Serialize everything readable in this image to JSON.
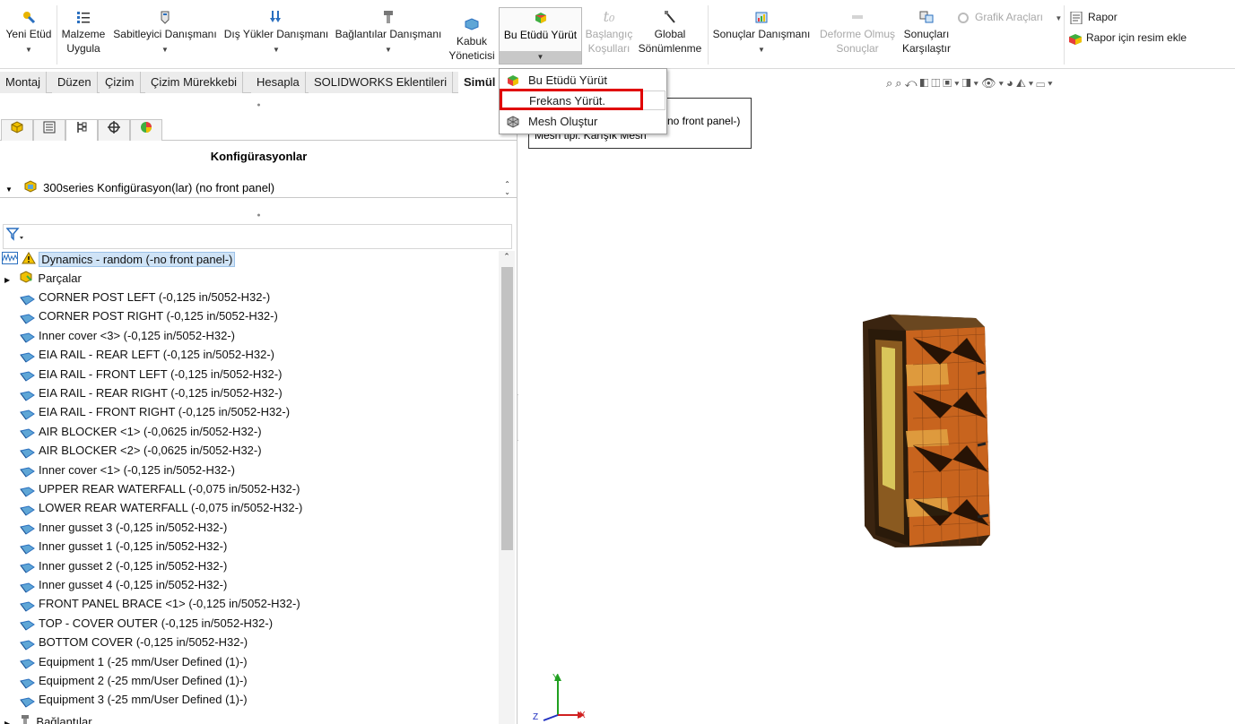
{
  "ribbon": {
    "yeni_etud": "Yeni Etüd",
    "malzeme_1": "Malzeme",
    "malzeme_2": "Uygula",
    "sabitleyici": "Sabitleyici Danışmanı",
    "dis_yukler": "Dış Yükler Danışmanı",
    "baglantilar": "Bağlantılar Danışmanı",
    "kabuk_1": "Kabuk",
    "kabuk_2": "Yöneticisi",
    "run": "Bu Etüdü Yürüt",
    "baslangic_1": "Başlangıç",
    "baslangic_2": "Koşulları",
    "global_1": "Global",
    "global_2": "Sönümlenme",
    "sonuclar": "Sonuçlar Danışmanı",
    "deforme_1": "Deforme Olmuş",
    "deforme_2": "Sonuçlar",
    "karsilastir_1": "Sonuçları",
    "karsilastir_2": "Karşılaştır",
    "grafik": "Grafik Araçları",
    "rapor": "Rapor",
    "rapor_resim": "Rapor için resim ekle"
  },
  "tabs": [
    "Montaj",
    "Düzen",
    "Çizim",
    "Çizim Mürekkebi",
    "Hesapla",
    "SOLIDWORKS Eklentileri",
    "Simül"
  ],
  "dropdown": {
    "items": [
      "Bu Etüdü Yürüt",
      "Frekans Yürüt.",
      "Mesh Oluştur"
    ]
  },
  "panel": {
    "title": "Konfigürasyonlar",
    "config": "300series Konfigürasyon(lar)  (no front panel)"
  },
  "tree": {
    "study": "Dynamics - random (-no front panel-)",
    "parts_label": "Parçalar",
    "parts": [
      "CORNER POST LEFT (-0,125 in/5052-H32-)",
      "CORNER POST RIGHT (-0,125 in/5052-H32-)",
      "Inner cover <3> (-0,125 in/5052-H32-)",
      "EIA RAIL - REAR LEFT (-0,125 in/5052-H32-)",
      "EIA RAIL - FRONT LEFT (-0,125 in/5052-H32-)",
      "EIA RAIL - REAR RIGHT (-0,125 in/5052-H32-)",
      "EIA RAIL - FRONT RIGHT (-0,125 in/5052-H32-)",
      "AIR BLOCKER <1> (-0,0625 in/5052-H32-)",
      "AIR BLOCKER <2> (-0,0625 in/5052-H32-)",
      "Inner cover <1> (-0,125 in/5052-H32-)",
      "UPPER REAR WATERFALL (-0,075 in/5052-H32-)",
      "LOWER REAR WATERFALL (-0,075 in/5052-H32-)",
      "Inner gusset 3 (-0,125 in/5052-H32-)",
      "Inner gusset 1 (-0,125 in/5052-H32-)",
      "Inner gusset 2 (-0,125 in/5052-H32-)",
      "Inner gusset 4 (-0,125 in/5052-H32-)",
      "FRONT PANEL BRACE <1> (-0,125 in/5052-H32-)",
      "TOP - COVER OUTER (-0,125 in/5052-H32-)",
      "BOTTOM COVER (-0,125 in/5052-H32-)",
      "Equipment 1 (-25 mm/User Defined (1)-)",
      "Equipment 2 (-25 mm/User Defined (1)-)",
      "Equipment 3 (-25 mm/User Defined (1)-)"
    ],
    "connections_label": "Bağlantılar"
  },
  "viewport": {
    "info_line1": "-no front panel-)",
    "info_line2": "Mesh tipi: Karışık Mesh",
    "axes": {
      "y": "Y",
      "x": "X",
      "z": "Z"
    }
  },
  "colors": {
    "highlight": "#e00000",
    "selection": "#cfe3f6",
    "mesh_orange": "#c8641e"
  }
}
